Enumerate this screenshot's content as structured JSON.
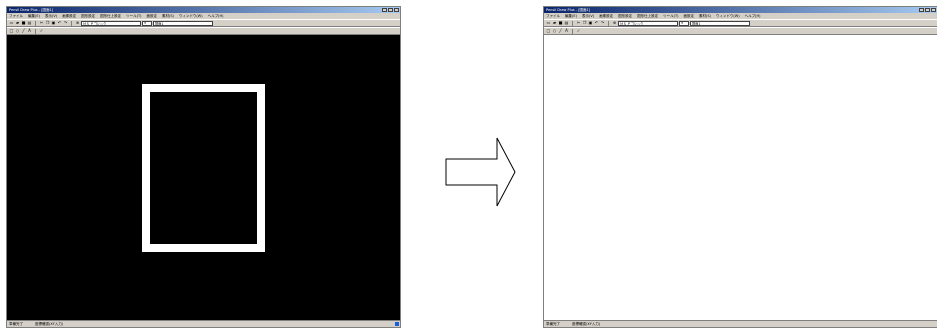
{
  "window_left": {
    "title": "Pensil Draw Plus - [図面1]",
    "menu": [
      "ファイル",
      "編集(E)",
      "表示(V)",
      "画像設定",
      "図形設定",
      "図形仕上設定",
      "ツール(T)",
      "面設定",
      "素材(S)",
      "ウィンドウ(W)",
      "ヘルプ(H)"
    ],
    "font_combo": "ＭＳ Ｐゴシック",
    "size_combo": "9",
    "layer_combo": "図面1",
    "status_left": "準備完了",
    "status_mid": "座標確認(XY入力)"
  },
  "window_right": {
    "title": "Pensil Draw Plus - [図面1]",
    "menu": [
      "ファイル",
      "編集(E)",
      "表示(V)",
      "画像設定",
      "図形設定",
      "図形仕上設定",
      "ツール(T)",
      "面設定",
      "素材(S)",
      "ウィンドウ(W)",
      "ヘルプ(H)"
    ],
    "font_combo": "ＭＳ Ｐゴシック",
    "size_combo": "9",
    "layer_combo": "図面1",
    "status_left": "準備完了",
    "status_mid": "座標確認(XY入力)"
  },
  "colors": {
    "canvas_before": "#000000",
    "canvas_after": "#ffffff",
    "drawn_shape": "#ffffff",
    "titlebar": "#0a246a",
    "chrome": "#d4d0c8"
  },
  "icons": [
    "new-icon",
    "open-icon",
    "save-icon",
    "print-icon",
    "cut-icon",
    "copy-icon",
    "paste-icon",
    "undo-icon",
    "redo-icon",
    "zoom-icon",
    "rectangle-tool-icon",
    "ellipse-tool-icon",
    "line-tool-icon",
    "text-tool-icon",
    "check-icon"
  ]
}
